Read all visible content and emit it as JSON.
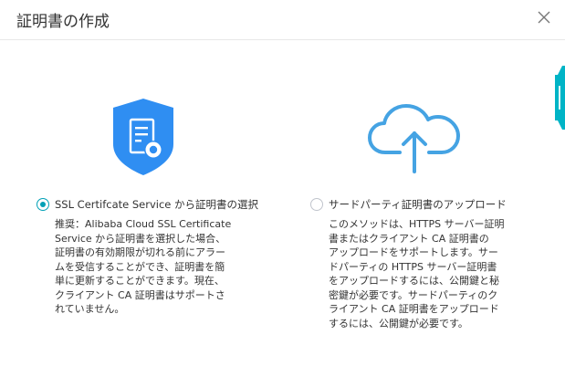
{
  "dialog": {
    "title": "証明書の作成",
    "close_icon": "close-icon"
  },
  "colors": {
    "accent": "#00a0b6",
    "shield_blue": "#2f8ef2",
    "cloud_blue": "#45a3e3"
  },
  "options": [
    {
      "id": "ssl",
      "icon": "certificate-shield-icon",
      "label": "SSL Certifcate Service から証明書の選択",
      "selected": true,
      "description_lines": [
        "推奨：Alibaba Cloud SSL Certificate",
        "Service から証明書を選択した場合、",
        "証明書の有効期限が切れる前にアラー",
        "ムを受信することができ、証明書を簡",
        "単に更新することができます。現在、",
        "クライアント CA 証明書はサポートさ",
        "れていません。"
      ]
    },
    {
      "id": "upload",
      "icon": "cloud-upload-icon",
      "label": "サードパーティ証明書のアップロード",
      "selected": false,
      "description_lines": [
        "このメソッドは、HTTPS サーバー証明",
        "書またはクライアント CA 証明書の",
        "アップロードをサポートします。サー",
        "ドパーティの HTTPS サーバー証明書",
        "をアップロードするには、公開鍵と秘",
        "密鍵が必要です。サードパーティのク",
        "ライアント CA 証明書をアップロード",
        "するには、公開鍵が必要です。"
      ]
    }
  ]
}
